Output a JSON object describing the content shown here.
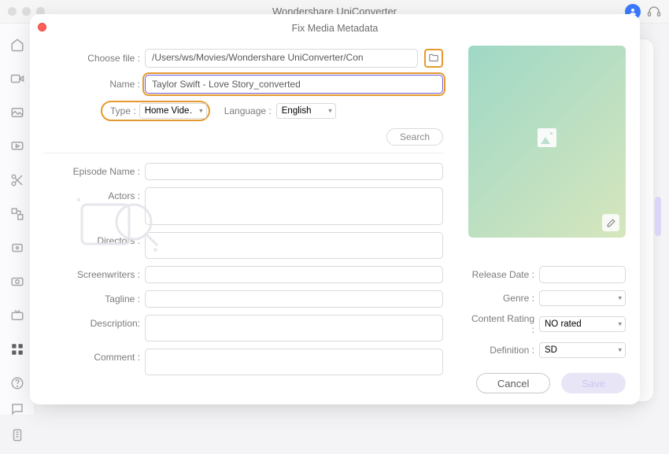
{
  "parentTitle": "Wondershare UniConverter",
  "sheetTitle": "Fix Media Metadata",
  "labels": {
    "chooseFile": "Choose file :",
    "name": "Name :",
    "type": "Type :",
    "language": "Language :",
    "episode": "Episode Name :",
    "actors": "Actors :",
    "directors": "Directors :",
    "screenwriters": "Screenwriters :",
    "tagline": "Tagline :",
    "description": "Description:",
    "comment": "Comment :",
    "releaseDate": "Release Date :",
    "genre": "Genre :",
    "contentRating": "Content Rating :",
    "definition": "Definition :"
  },
  "values": {
    "filePath": "/Users/ws/Movies/Wondershare UniConverter/Con",
    "name": "Taylor Swift - Love Story_converted",
    "typeSelected": "Home Vide…",
    "languageSelected": "English",
    "episode": "",
    "actors": "",
    "directors": "",
    "screenwriters": "",
    "tagline": "",
    "description": "",
    "comment": "",
    "releaseDate": "",
    "genreSelected": "",
    "contentRatingSelected": "NO rated",
    "definitionSelected": "SD"
  },
  "buttons": {
    "search": "Search",
    "cancel": "Cancel",
    "save": "Save"
  }
}
